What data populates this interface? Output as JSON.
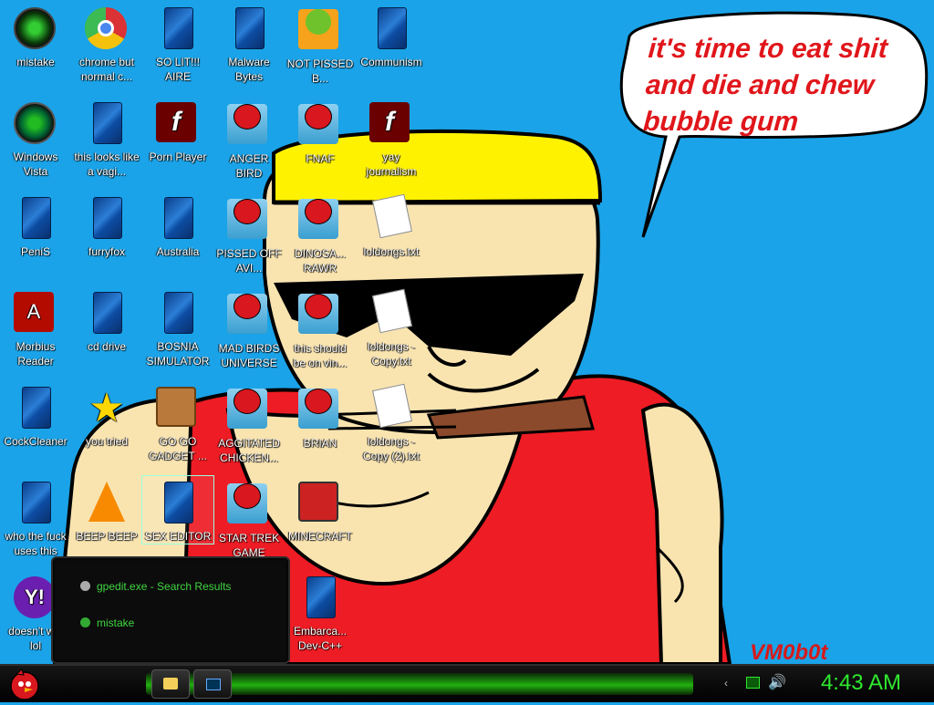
{
  "speech_bubble": {
    "line1": "it's time to eat shit",
    "line2": "and die and chew",
    "line3": "bubble gum"
  },
  "watermark": "VM0b0t",
  "desktop_icons": [
    {
      "label": "mistake",
      "icon": "mistake-app-icon"
    },
    {
      "label": "chrome but normal c...",
      "icon": "chrome-icon"
    },
    {
      "label": "SO LIT!!! AIRE",
      "icon": "document-icon"
    },
    {
      "label": "Malware Bytes",
      "icon": "document-icon"
    },
    {
      "label": "NOT PISSED B...",
      "icon": "bad-piggies-icon"
    },
    {
      "label": "Communism",
      "icon": "document-icon"
    },
    {
      "label": "Windows Vista",
      "icon": "recycle-icon"
    },
    {
      "label": "this looks like a vagi...",
      "icon": "document-icon"
    },
    {
      "label": "Porn Player",
      "icon": "flash-icon"
    },
    {
      "label": "ANGER BIRD",
      "icon": "angry-birds-icon"
    },
    {
      "label": "FNAF",
      "icon": "angry-birds-icon"
    },
    {
      "label": "yay journalism",
      "icon": "flash-icon"
    },
    {
      "label": "PeniS",
      "icon": "document-icon"
    },
    {
      "label": "furryfox",
      "icon": "document-icon"
    },
    {
      "label": "Australia",
      "icon": "document-icon"
    },
    {
      "label": "PISSED OFF AVI...",
      "icon": "angry-birds-seasons-icon"
    },
    {
      "label": "DINOSA... RAWR",
      "icon": "angry-birds-icon"
    },
    {
      "label": "loldongs.txt",
      "icon": "text-file-icon"
    },
    {
      "label": "Morbius Reader",
      "icon": "pdf-icon"
    },
    {
      "label": "cd drive",
      "icon": "document-icon"
    },
    {
      "label": "BOSNIA SIMULATOR",
      "icon": "document-icon"
    },
    {
      "label": "MAD BIRDS UNIVERSE",
      "icon": "angry-birds-space-icon"
    },
    {
      "label": "this should be on vin...",
      "icon": "angry-birds-icon"
    },
    {
      "label": "loldongs - Copy.txt",
      "icon": "text-file-icon"
    },
    {
      "label": "CockCleaner",
      "icon": "document-icon"
    },
    {
      "label": "you tried",
      "icon": "star-icon"
    },
    {
      "label": "GO GO GADGET ...",
      "icon": "briefcase-icon"
    },
    {
      "label": "AGGITATED CHICKEN...",
      "icon": "angry-birds-icon"
    },
    {
      "label": "BRIAN",
      "icon": "angry-birds-stella-icon"
    },
    {
      "label": "loldongs - Copy (2).txt",
      "icon": "text-file-icon"
    },
    {
      "label": "who the fuck uses this",
      "icon": "document-icon"
    },
    {
      "label": "BEEP BEEP",
      "icon": "vlc-icon"
    },
    {
      "label": "SEX EDITOR",
      "icon": "document-icon"
    },
    {
      "label": "STAR TREK GAME",
      "icon": "angry-birds-star-wars-icon"
    },
    {
      "label": "MINECRAFT",
      "icon": "minecraft-birds-icon"
    },
    {
      "label": "doesn't w... lol",
      "icon": "yahoo-icon"
    },
    {
      "label": "Embarca... Dev-C++",
      "icon": "document-icon"
    }
  ],
  "search_popup": {
    "result1": "gpedit.exe - Search Results",
    "result2": "mistake"
  },
  "taskbar": {
    "clock": "4:43 AM",
    "start_icon": "angry-bird-start-icon"
  },
  "colors": {
    "background": "#1aa3e8",
    "bubble_text": "#e0161b",
    "clock": "#2fe82f",
    "search_text": "#3fd63f"
  }
}
